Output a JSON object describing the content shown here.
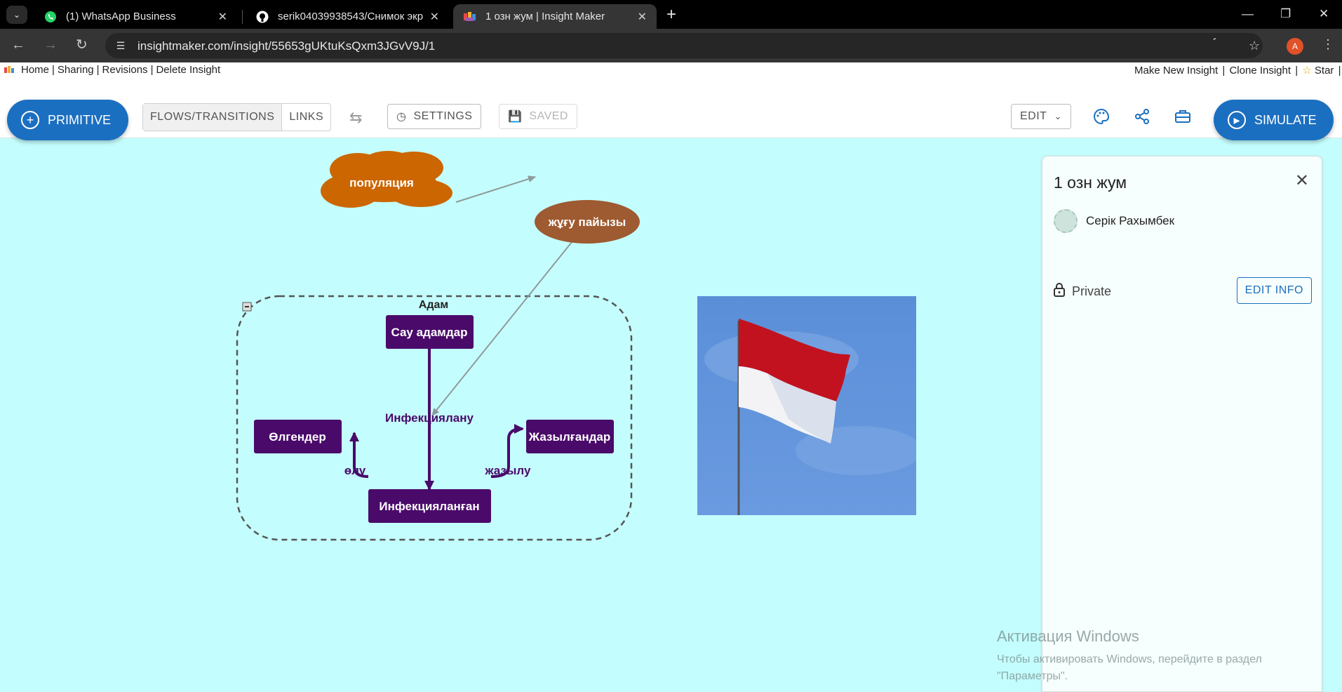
{
  "browser": {
    "tabs": [
      {
        "title": "(1) WhatsApp Business",
        "favicon": "whatsapp-icon"
      },
      {
        "title": "serik04039938543/Снимок экр",
        "favicon": "github-icon"
      },
      {
        "title": "1 озн жум | Insight Maker",
        "favicon": "insightmaker-icon"
      }
    ],
    "url": "insightmaker.com/insight/55653gUKtuKsQxm3JGvV9J/1",
    "profile_initial": "A"
  },
  "toplinks": {
    "home": "Home",
    "sharing": "Sharing",
    "revisions": "Revisions",
    "delete": "Delete Insight",
    "make_new": "Make New Insight",
    "clone": "Clone Insight",
    "star": "Star",
    "sep": "|"
  },
  "toolbar": {
    "primitive": "PRIMITIVE",
    "flows_transitions": "FLOWS/TRANSITIONS",
    "links": "LINKS",
    "settings": "SETTINGS",
    "saved": "SAVED",
    "edit": "EDIT",
    "simulate": "SIMULATE"
  },
  "diagram": {
    "cloud_label": "популяция",
    "oval_label": "жұғу пайызы",
    "folder_label": "Адам",
    "stock_healthy": "Сау адамдар",
    "stock_infected": "Инфекцияланған",
    "stock_dead": "Өлгендер",
    "stock_recovered": "Жазылғандар",
    "flow_infection": "Инфекциялану",
    "flow_death": "өлу",
    "flow_recovery": "жазылу",
    "stock_color": "#4a0a6a",
    "cloud_color": "#cc6600",
    "oval_color": "#9e5a30",
    "canvas_color": "#c4fdfd"
  },
  "panel": {
    "title": "1 озн жум",
    "author": "Серік Рахымбек",
    "visibility": "Private",
    "edit_info": "EDIT INFO"
  },
  "watermark": {
    "line1": "Активация Windows",
    "line2": "Чтобы активировать Windows, перейдите в раздел \"Параметры\"."
  }
}
